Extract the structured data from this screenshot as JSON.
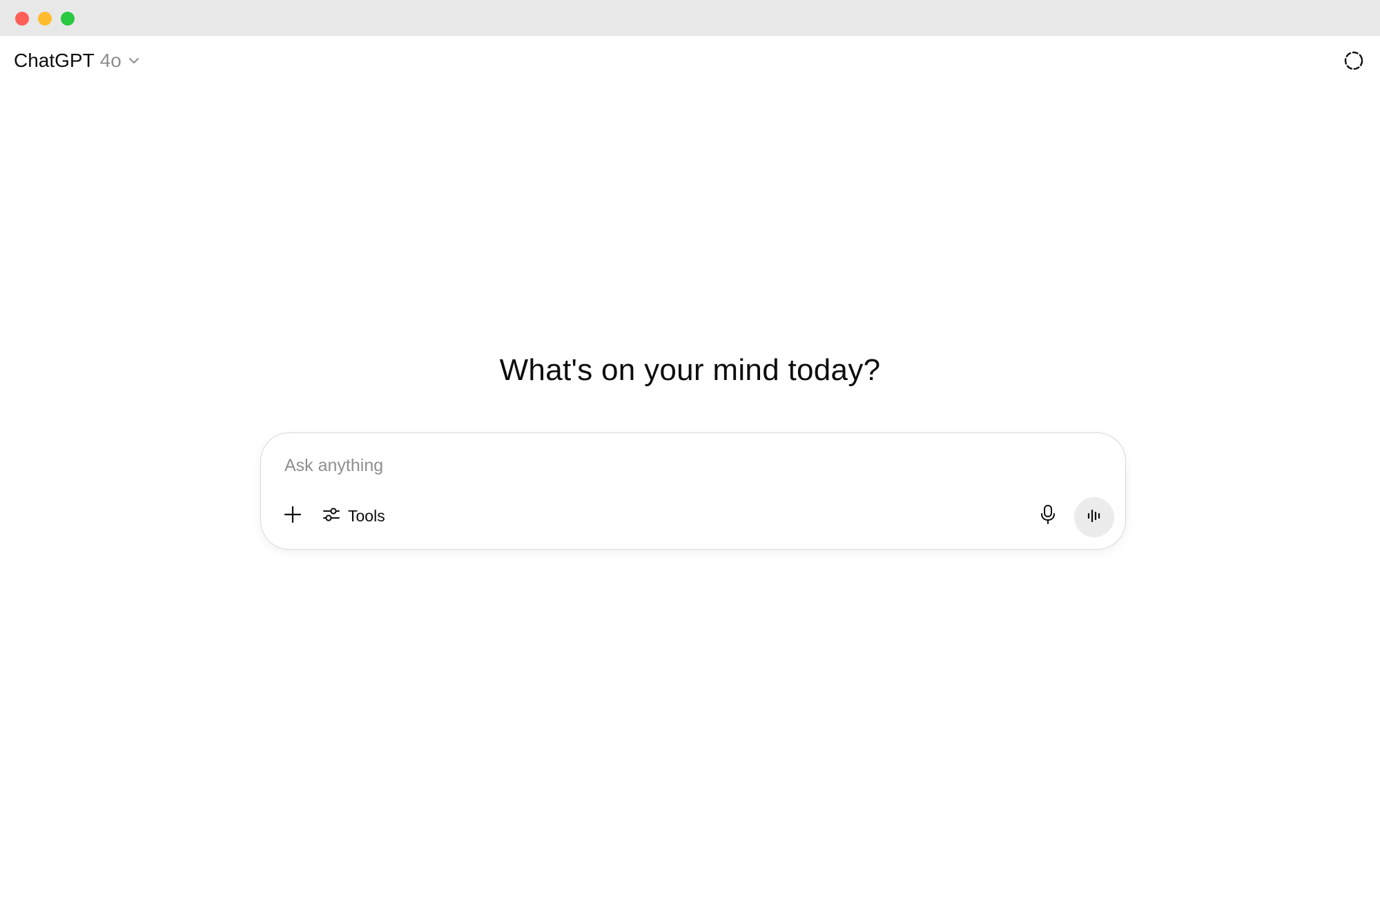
{
  "window": {
    "controls": {
      "close_color": "#fe5f57",
      "minimize_color": "#febc2e",
      "maximize_color": "#28c840"
    }
  },
  "header": {
    "app_name": "ChatGPT",
    "model_version": "4o",
    "chevron_icon": "chevron-down-icon",
    "temporary_chat_icon": "dashed-circle-icon"
  },
  "main": {
    "greeting": "What's on your mind today?"
  },
  "composer": {
    "placeholder": "Ask anything",
    "value": "",
    "plus_icon": "plus-icon",
    "tools_icon": "sliders-icon",
    "tools_label": "Tools",
    "mic_icon": "microphone-icon",
    "voice_icon": "voice-waveform-icon"
  }
}
